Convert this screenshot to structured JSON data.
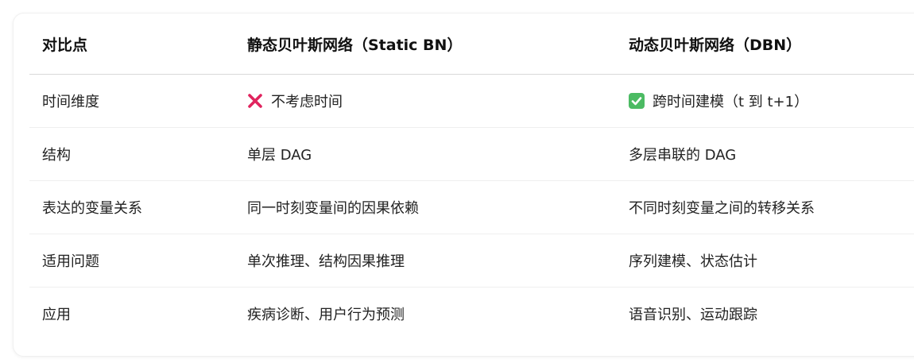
{
  "table": {
    "headers": [
      "对比点",
      "静态贝叶斯网络（Static BN）",
      "动态贝叶斯网络（DBN）"
    ],
    "rows": [
      {
        "point": "时间维度",
        "static": "不考虑时间",
        "static_icon": "cross-mark-icon",
        "dynamic": "跨时间建模（t 到 t+1）",
        "dynamic_icon": "check-mark-icon"
      },
      {
        "point": "结构",
        "static": "单层 DAG",
        "dynamic": "多层串联的 DAG"
      },
      {
        "point": "表达的变量关系",
        "static": "同一时刻变量间的因果依赖",
        "dynamic": "不同时刻变量之间的转移关系"
      },
      {
        "point": "适用问题",
        "static": "单次推理、结构因果推理",
        "dynamic": "序列建模、状态估计"
      },
      {
        "point": "应用",
        "static": "疾病诊断、用户行为预测",
        "dynamic": "语音识别、运动跟踪"
      }
    ]
  },
  "colors": {
    "cross": "#e0245e",
    "check": "#4cbb63",
    "header_border": "#d9d9d9",
    "row_border": "#efefef"
  }
}
